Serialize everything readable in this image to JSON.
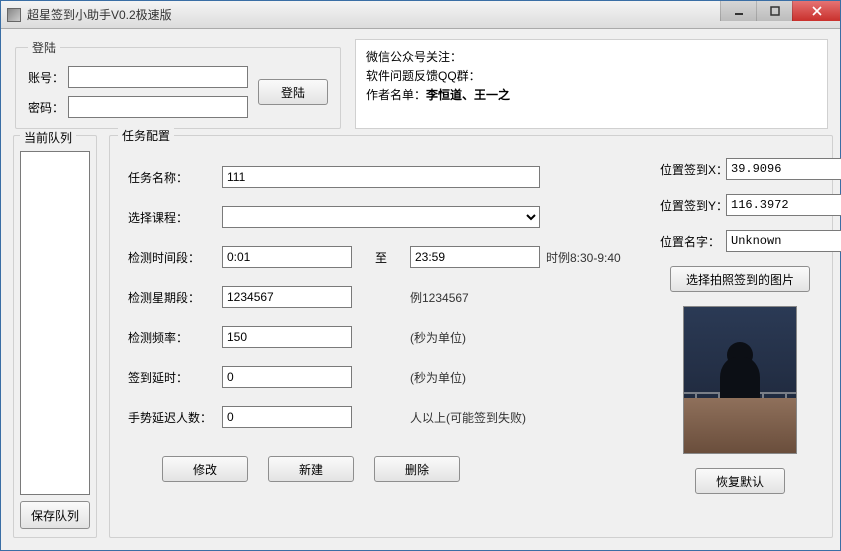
{
  "window": {
    "title": "超星签到小助手V0.2极速版"
  },
  "login": {
    "legend": "登陆",
    "account_label": "账号：",
    "password_label": "密码：",
    "login_button": "登陆",
    "account_value": "",
    "password_value": ""
  },
  "info": {
    "line1": "微信公众号关注：",
    "line2": "软件问题反馈QQ群：",
    "line3_prefix": "作者名单：",
    "authors": "李恒道、王一之"
  },
  "queue": {
    "legend": "当前队列",
    "save_button": "保存队列"
  },
  "task": {
    "legend": "任务配置",
    "name_label": "任务名称：",
    "name_value": "111",
    "course_label": "选择课程：",
    "course_value": "",
    "timerange_label": "检测时间段：",
    "time_from": "0:01",
    "time_to_label": "至",
    "time_to": "23:59",
    "time_hint": "时例8:30-9:40",
    "weekday_label": "检测星期段：",
    "weekday_value": "1234567",
    "weekday_hint": "例1234567",
    "freq_label": "检测频率：",
    "freq_value": "150",
    "freq_unit": "(秒为单位)",
    "delay_label": "签到延时：",
    "delay_value": "0",
    "delay_unit": "(秒为单位)",
    "gesture_label": "手势延迟人数：",
    "gesture_value": "0",
    "gesture_hint": "人以上(可能签到失败)",
    "btn_modify": "修改",
    "btn_new": "新建",
    "btn_delete": "删除"
  },
  "location": {
    "x_label": "位置签到X：",
    "x_value": "39.9096",
    "y_label": "位置签到Y：",
    "y_value": "116.3972",
    "name_label": "位置名字：",
    "name_value": "Unknown",
    "choose_image_button": "选择拍照签到的图片",
    "restore_button": "恢复默认"
  }
}
